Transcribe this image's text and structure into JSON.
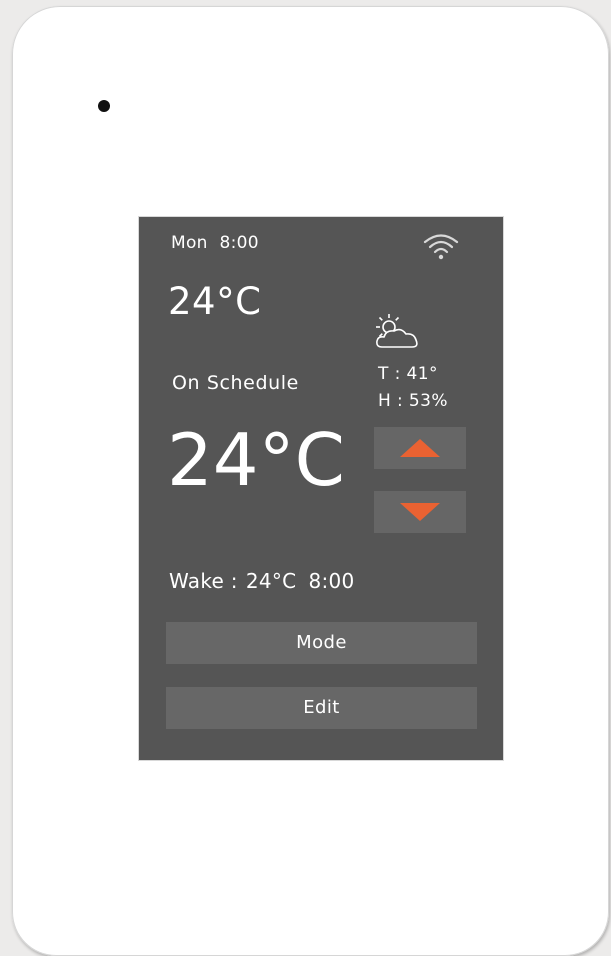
{
  "header": {
    "day": "Mon",
    "time": "8:00"
  },
  "current": {
    "room_temperature": "24°C"
  },
  "weather": {
    "icon": "partly-cloudy-icon",
    "temperature_label": "T : 41°",
    "humidity_label": "H : 53%"
  },
  "thermostat": {
    "status": "On Schedule",
    "setpoint": "24°C"
  },
  "schedule": {
    "period": "Wake :",
    "temperature": "24°C",
    "time": "8:00"
  },
  "buttons": {
    "mode_label": "Mode",
    "edit_label": "Edit"
  },
  "colors": {
    "screen_background": "#555555",
    "button_background": "#676767",
    "arrow_accent": "#ea6232",
    "device_body": "#ffffff"
  }
}
